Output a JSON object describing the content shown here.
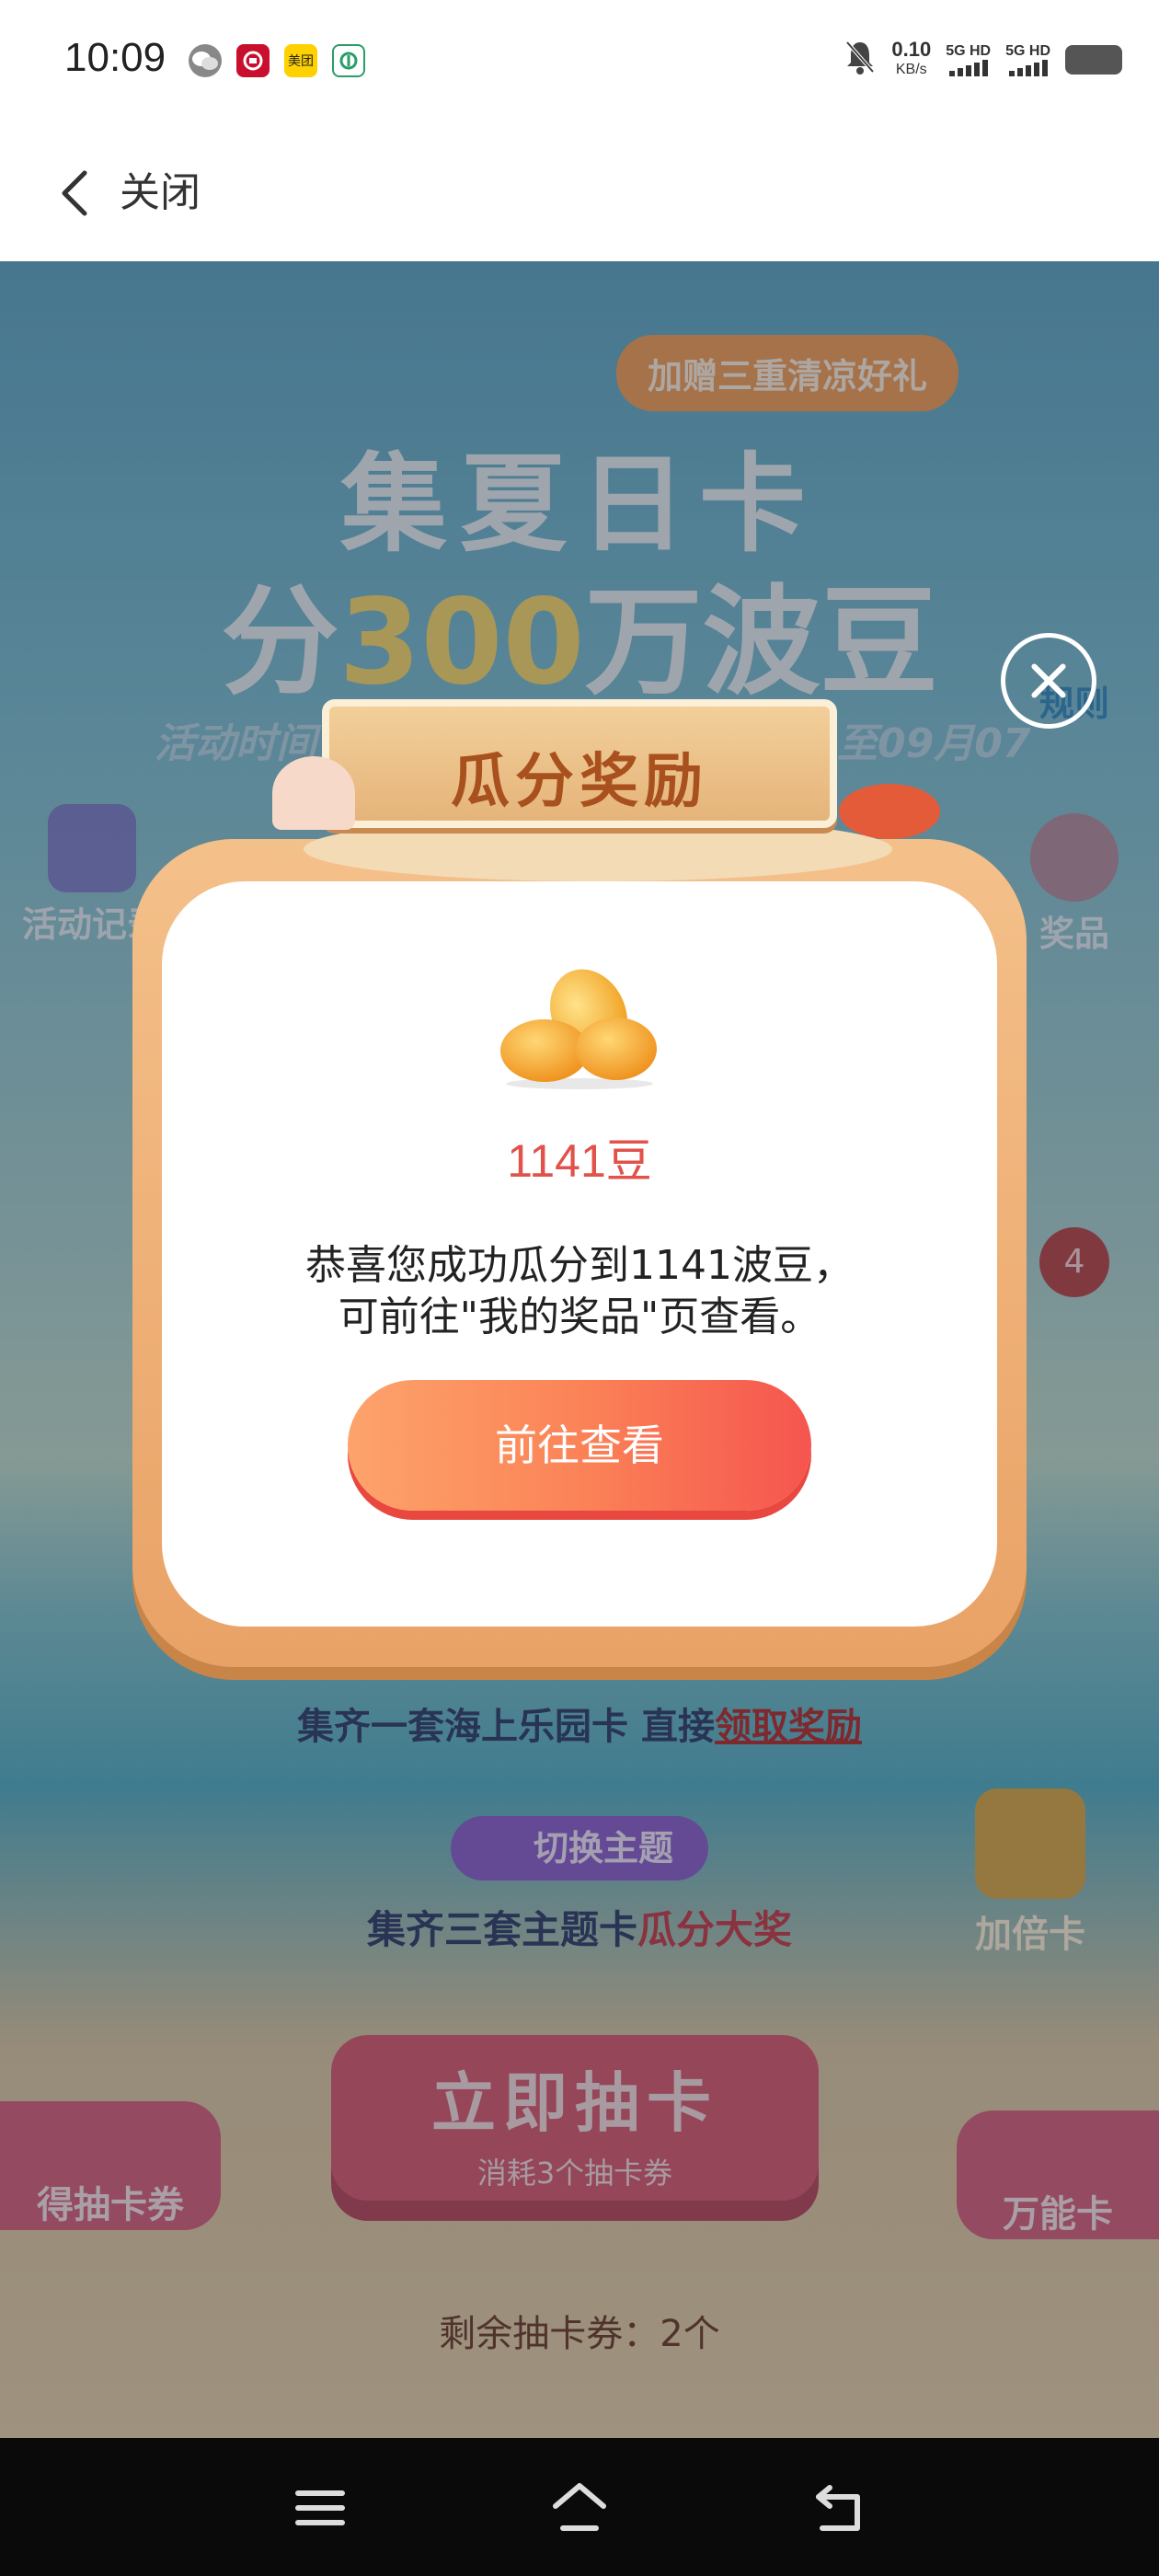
{
  "status_bar": {
    "time": "10:09",
    "app_icons": [
      "wechat-icon",
      "bank-app-icon",
      "meituan-icon",
      "telecom-app-icon"
    ],
    "meituan_label": "美团",
    "net_speed": "0.10",
    "net_unit": "KB/s",
    "signal1": "5G HD",
    "signal2": "5G HD"
  },
  "nav": {
    "close_label": "关闭"
  },
  "background": {
    "banner": "加赠三重清凉好礼",
    "title_line1": "集夏日卡",
    "title_line2_prefix": "分",
    "title_line2_number": "300",
    "title_line2_suffix": "万波豆",
    "time_left": "活动时间",
    "time_right": "至09月07",
    "rules_label": "规则",
    "prizes_label": "奖品",
    "records_label": "活动记录",
    "collect_text": "集齐一套海上乐园卡 直接",
    "collect_link": "领取奖励",
    "switch_theme": "切换主题",
    "theme_text": "集齐三套主题卡",
    "theme_highlight": "瓜分大奖",
    "double_card": "加倍卡",
    "draw_button": "立即抽卡",
    "draw_cost": "消耗3个抽卡券",
    "get_ticket": "得抽卡券",
    "universal_card": "万能卡",
    "remaining": "剩余抽卡券：2个",
    "badge_count": "4"
  },
  "modal": {
    "title": "瓜分奖励",
    "amount": "1141豆",
    "message_line1": "恭喜您成功瓜分到1141波豆，",
    "message_line2": "可前往\"我的奖品\"页查看。",
    "button": "前往查看"
  },
  "colors": {
    "accent_orange": "#fb8357",
    "amount_red": "#e0524a",
    "frame_wood": "#e9a266"
  }
}
